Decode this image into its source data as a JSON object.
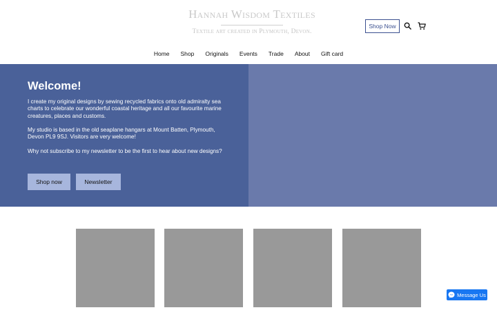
{
  "brand": {
    "title": "Hannah Wisdom Textiles",
    "tagline": "Textile art created in Plymouth, Devon."
  },
  "header": {
    "shop_now_label": "Shop Now",
    "icons": {
      "search": "search-icon",
      "cart": "cart-icon"
    }
  },
  "nav": {
    "items": [
      {
        "label": "Home"
      },
      {
        "label": "Shop"
      },
      {
        "label": "Originals"
      },
      {
        "label": "Events"
      },
      {
        "label": "Trade"
      },
      {
        "label": "About"
      },
      {
        "label": "Gift card"
      }
    ]
  },
  "hero": {
    "heading": "Welcome!",
    "paragraphs": [
      "I create my original designs by sewing recycled fabrics onto old admiralty sea charts to celebrate our wonderful coastal heritage and all our favourite marine creatures, places and customs.",
      "My studio is based in the old seaplane hangars at Mount Batten, Plymouth, Devon PL9 9SJ. Visitors are very welcome!",
      "Why not subscribe to my newsletter to be the first to hear about new designs?"
    ],
    "buttons": {
      "shop_now": "Shop now",
      "newsletter": "Newsletter"
    }
  },
  "messenger": {
    "label": "Message Us",
    "icon": "messenger-icon"
  },
  "colors": {
    "hero_left": "#4a6199",
    "hero_right": "#6a7aab",
    "hero_button": "#a7b6dd",
    "accent": "#3a4f8f",
    "tile": "#999999",
    "messenger": "#1877f2"
  }
}
